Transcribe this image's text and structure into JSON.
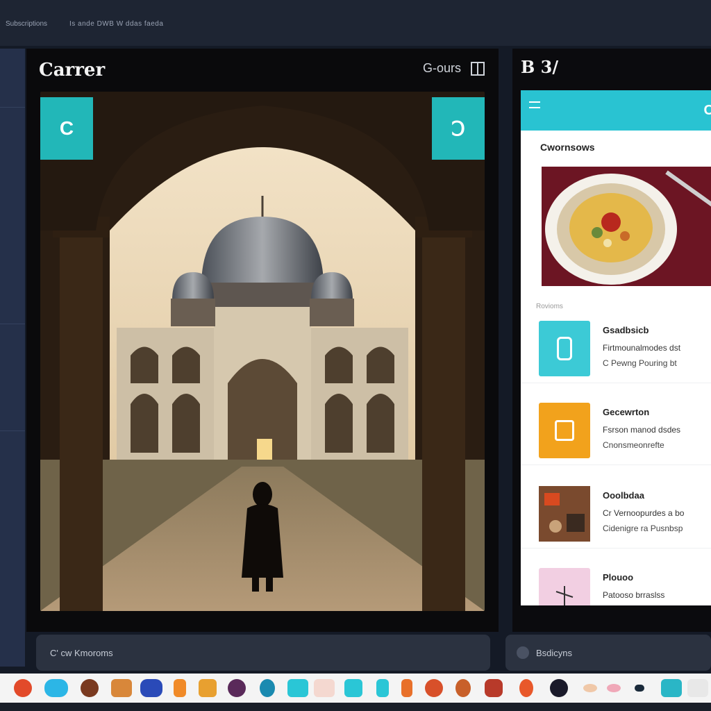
{
  "topbar": {
    "left_text": "Subscriptions",
    "center_text": "Is ande DWB W ddas faeda"
  },
  "viewer": {
    "title": "Carrer",
    "tool_label": "G-ours",
    "prev_label": "C",
    "next_label": "Ↄ"
  },
  "right_panel": {
    "title": "B 3/",
    "header_letter": "C",
    "section_title": "Cwornsows",
    "sub_label": "Rovioms",
    "items": [
      {
        "title": "Gsadbsicb",
        "line1": "Firtmounalmodes dst",
        "line2": "C Pewng Pouring bt",
        "icon": "phone-icon",
        "color": "#3ccad6"
      },
      {
        "title": "Gecewrton",
        "line1": "Fsrson manod dsdes",
        "line2": "Cnonsmeonrefte",
        "icon": "square-icon",
        "color": "#f2a21c"
      },
      {
        "title": "Ooolbdaa",
        "line1": "Cr Vernoopurdes a bo",
        "line2": "Cidenigre ra Pusnbsp",
        "icon": "photo-icon",
        "color": "#8a5a3a"
      },
      {
        "title": "Plouoo",
        "line1": "Patooso brraslss",
        "line2": "",
        "icon": "sketch-icon",
        "color": "#f2cfe2"
      }
    ]
  },
  "bottom": {
    "left_input": "C' cw Kmoroms",
    "right_input": "Bsdicyns"
  },
  "colors": {
    "accent": "#22b7b8",
    "header": "#29c3d2",
    "orange": "#f2a21c"
  }
}
